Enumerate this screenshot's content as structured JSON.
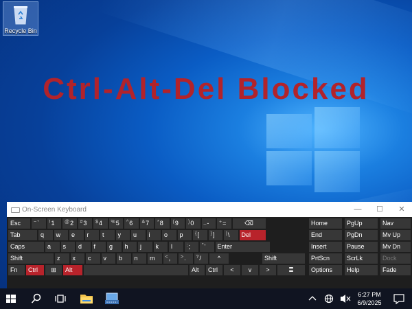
{
  "desktop": {
    "recycle_bin_label": "Recycle Bin",
    "banner_text": "Ctrl-Alt-Del Blocked"
  },
  "osk": {
    "title": "On-Screen Keyboard",
    "controls": {
      "minimize": "—",
      "maximize": "☐",
      "close": "✕"
    }
  },
  "keys": {
    "esc": "Esc",
    "num_row": [
      {
        "shift": "~",
        "main": "`"
      },
      {
        "shift": "!",
        "main": "1"
      },
      {
        "shift": "@",
        "main": "2"
      },
      {
        "shift": "#",
        "main": "3"
      },
      {
        "shift": "$",
        "main": "4"
      },
      {
        "shift": "%",
        "main": "5"
      },
      {
        "shift": "^",
        "main": "6"
      },
      {
        "shift": "&",
        "main": "7"
      },
      {
        "shift": "*",
        "main": "8"
      },
      {
        "shift": "(",
        "main": "9"
      },
      {
        "shift": ")",
        "main": "0"
      },
      {
        "shift": "_",
        "main": "-"
      },
      {
        "shift": "+",
        "main": "="
      }
    ],
    "backspace": "⌫",
    "tab": "Tab",
    "row_q": [
      "q",
      "w",
      "e",
      "r",
      "t",
      "y",
      "u",
      "i",
      "o",
      "p"
    ],
    "row_q_brackets": [
      {
        "shift": "{",
        "main": "["
      },
      {
        "shift": "}",
        "main": "]"
      },
      {
        "shift": "|",
        "main": "\\"
      }
    ],
    "del": "Del",
    "caps": "Caps",
    "row_a": [
      "a",
      "s",
      "d",
      "f",
      "g",
      "h",
      "j",
      "k",
      "l"
    ],
    "row_a_punct": [
      {
        "shift": ":",
        "main": ";"
      },
      {
        "shift": "\"",
        "main": "'"
      }
    ],
    "enter": "Enter",
    "shift_left": "Shift",
    "row_z": [
      "z",
      "x",
      "c",
      "v",
      "b",
      "n",
      "m"
    ],
    "row_z_punct": [
      {
        "shift": "<",
        "main": ","
      },
      {
        "shift": ">",
        "main": "."
      },
      {
        "shift": "?",
        "main": "/"
      }
    ],
    "up_arrow": "^",
    "shift_right": "Shift",
    "fn": "Fn",
    "ctrl_left": "Ctrl",
    "win": "⊞",
    "alt_left": "Alt",
    "alt_right": "Alt",
    "ctrl_right": "Ctrl",
    "left_arrow": "<",
    "down_arrow": "v",
    "right_arrow": ">",
    "menu_icon": "≣",
    "nav_block": [
      [
        "Home",
        "PgUp",
        "Nav"
      ],
      [
        "End",
        "PgDn",
        "Mv Up"
      ],
      [
        "Insert",
        "Pause",
        "Mv Dn"
      ],
      [
        "PrtScn",
        "ScrLk",
        "Dock"
      ],
      [
        "Options",
        "Help",
        "Fade"
      ]
    ]
  },
  "taskbar": {
    "time": "6:27 PM",
    "date": "6/9/2025"
  },
  "colors": {
    "accent_red": "#b8232b",
    "banner_red": "#b2232b",
    "key_bg": "#373737",
    "taskbar_bg": "#101421"
  }
}
